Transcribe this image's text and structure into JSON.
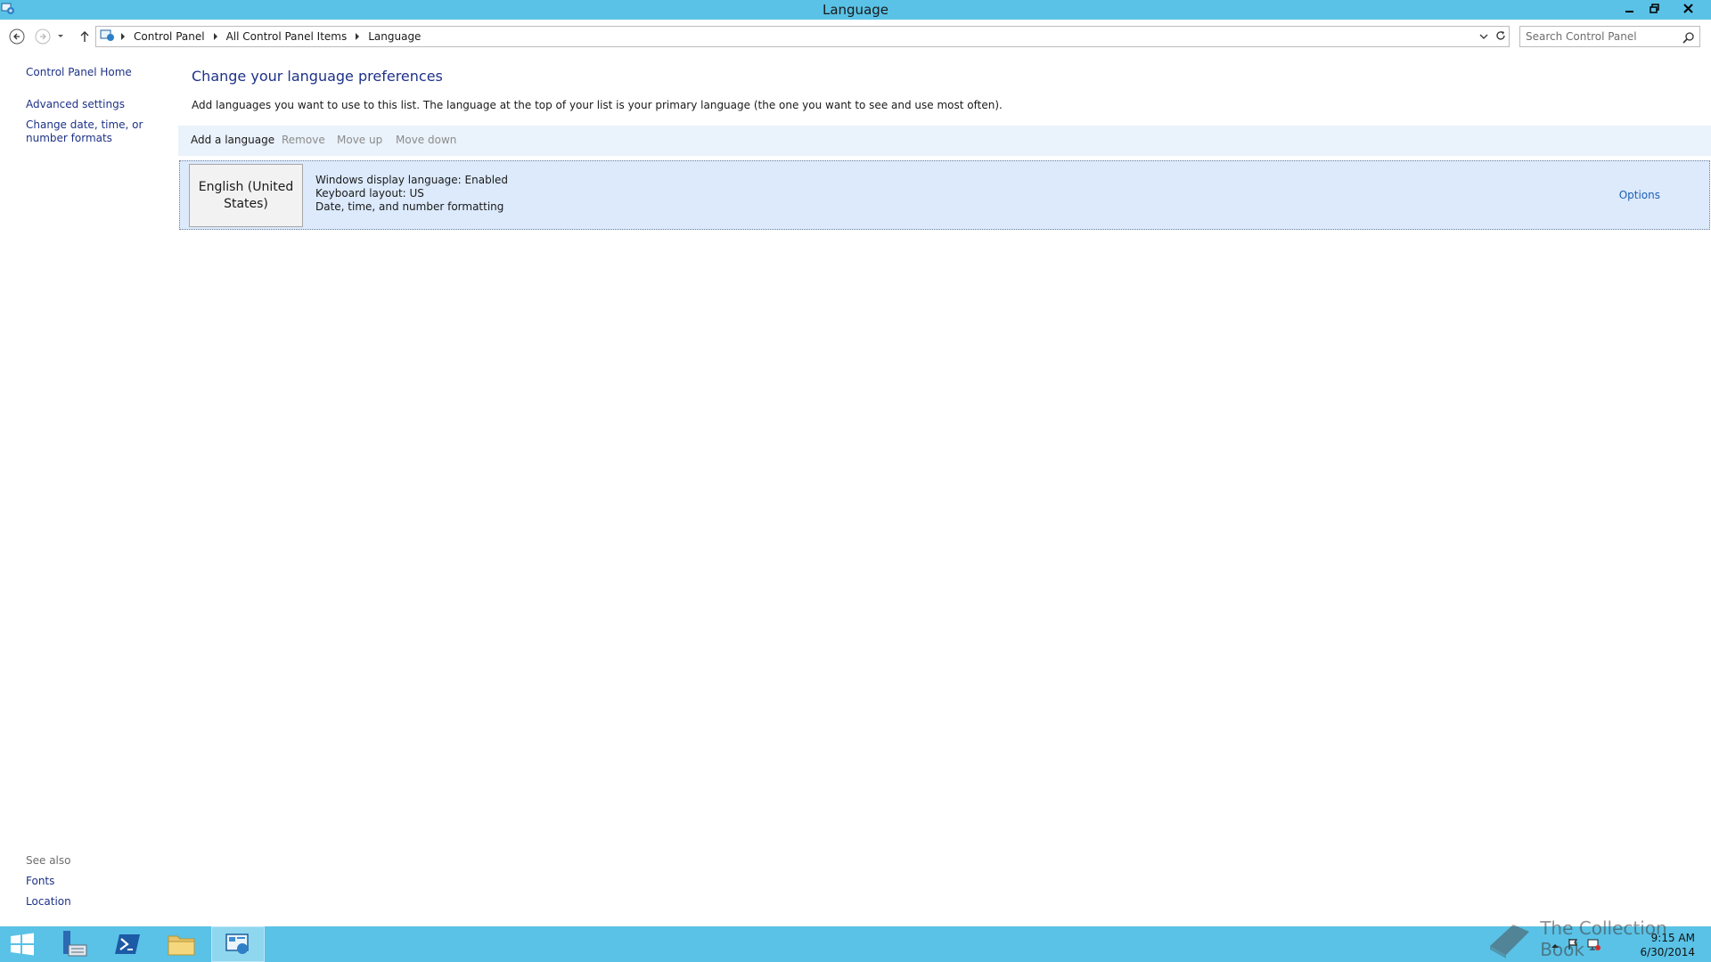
{
  "window": {
    "title": "Language"
  },
  "nav": {
    "breadcrumbs": [
      "Control Panel",
      "All Control Panel Items",
      "Language"
    ],
    "search_placeholder": "Search Control Panel"
  },
  "left_pane": {
    "links": [
      "Control Panel Home",
      "Advanced settings",
      "Change date, time, or number formats"
    ],
    "see_also_label": "See also",
    "see_also_links": [
      "Fonts",
      "Location"
    ]
  },
  "main": {
    "heading": "Change your language preferences",
    "description": "Add languages you want to use to this list. The language at the top of your list is your primary language (the one you want to see and use most often).",
    "toolbar": {
      "add_label": "Add a language",
      "remove_label": "Remove",
      "move_up_label": "Move up",
      "move_down_label": "Move down"
    },
    "languages": [
      {
        "name": "English (United States)",
        "details": [
          "Windows display language: Enabled",
          "Keyboard layout: US",
          "Date, time, and number formatting"
        ],
        "options_label": "Options"
      }
    ]
  },
  "taskbar": {
    "time": "9:15 AM",
    "date": "6/30/2014",
    "watermark": "The Collection Book"
  },
  "colors": {
    "titlebar": "#5ac2e6",
    "link": "#1e3287",
    "toolbar_bg": "#eaf2fb",
    "selected_row": "#dceafc"
  }
}
